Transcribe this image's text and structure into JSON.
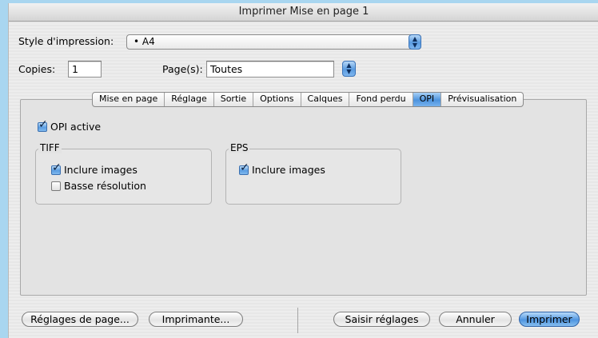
{
  "window": {
    "title": "Imprimer Mise en page 1"
  },
  "style": {
    "label": "Style d'impression:",
    "value": "• A4"
  },
  "copies": {
    "label": "Copies:",
    "value": "1"
  },
  "pages": {
    "label": "Page(s):",
    "value": "Toutes"
  },
  "tabs": [
    {
      "label": "Mise en page",
      "active": false
    },
    {
      "label": "Réglage",
      "active": false
    },
    {
      "label": "Sortie",
      "active": false
    },
    {
      "label": "Options",
      "active": false
    },
    {
      "label": "Calques",
      "active": false
    },
    {
      "label": "Fond perdu",
      "active": false
    },
    {
      "label": "OPI",
      "active": true
    },
    {
      "label": "Prévisualisation",
      "active": false
    }
  ],
  "opi": {
    "active_label": "OPI active",
    "active_checked": true,
    "tiff": {
      "title": "TIFF",
      "include_label": "Inclure images",
      "include_checked": true,
      "lowres_label": "Basse résolution",
      "lowres_checked": false
    },
    "eps": {
      "title": "EPS",
      "include_label": "Inclure images",
      "include_checked": true
    }
  },
  "buttons": {
    "page_setup": "Réglages de page...",
    "printer": "Imprimante...",
    "capture": "Saisir réglages",
    "cancel": "Annuler",
    "print": "Imprimer"
  },
  "icons": {
    "popup": "up-down-arrows-icon",
    "check": "checkmark-icon"
  },
  "colors": {
    "accent": "#5a9be0",
    "desktop": "#a9d6f0"
  }
}
